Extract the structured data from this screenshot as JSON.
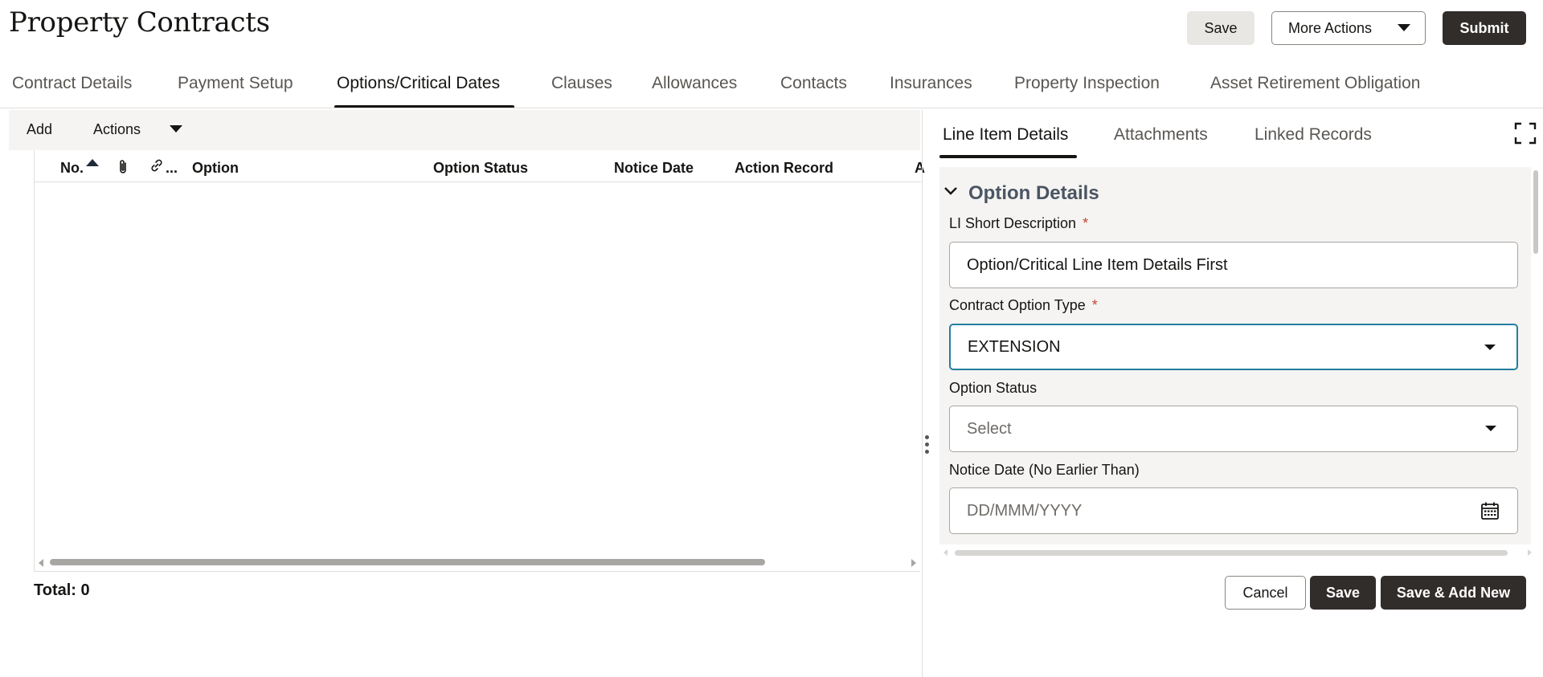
{
  "header": {
    "title": "Property Contracts",
    "save_label": "Save",
    "more_actions_label": "More Actions",
    "submit_label": "Submit"
  },
  "tabs": [
    {
      "label": "Contract Details"
    },
    {
      "label": "Payment Setup"
    },
    {
      "label": "Options/Critical Dates",
      "active": true
    },
    {
      "label": "Clauses"
    },
    {
      "label": "Allowances"
    },
    {
      "label": "Contacts"
    },
    {
      "label": "Insurances"
    },
    {
      "label": "Property Inspection"
    },
    {
      "label": "Asset Retirement Obligation"
    }
  ],
  "toolbar": {
    "add_label": "Add",
    "actions_label": "Actions"
  },
  "grid": {
    "columns": [
      "No.",
      "attachment-icon",
      "link-icon",
      "Option",
      "Option Status",
      "Notice Date",
      "Action Record",
      "A"
    ],
    "link_suffix": "...",
    "rows": [],
    "total_label": "Total: 0"
  },
  "detail": {
    "tabs": [
      {
        "label": "Line Item Details",
        "active": true
      },
      {
        "label": "Attachments"
      },
      {
        "label": "Linked Records"
      }
    ],
    "section_title": "Option Details",
    "fields": {
      "short_desc": {
        "label": "LI Short Description",
        "required": "*",
        "value": "Option/Critical Line Item Details First"
      },
      "option_type": {
        "label": "Contract Option Type",
        "required": "*",
        "value": "EXTENSION"
      },
      "option_status": {
        "label": "Option Status",
        "value": "Select"
      },
      "notice_date": {
        "label": "Notice Date (No Earlier Than)",
        "placeholder": "DD/MMM/YYYY"
      }
    },
    "buttons": {
      "cancel": "Cancel",
      "save": "Save",
      "save_add_new": "Save & Add New"
    }
  },
  "colors": {
    "primary_button": "#312d2a",
    "focus_border": "#227e9e",
    "required": "#c74634",
    "section_title": "#4a5563"
  }
}
